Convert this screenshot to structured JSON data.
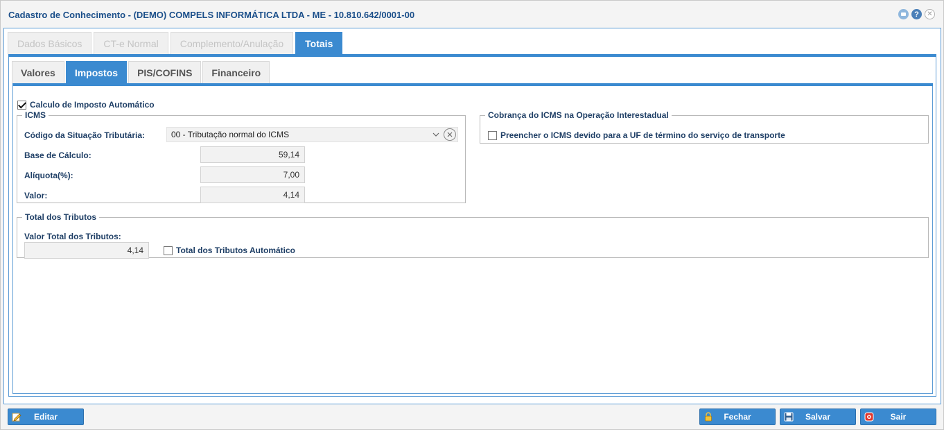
{
  "window": {
    "title": "Cadastro de Conhecimento - (DEMO) COMPELS INFORMÁTICA LTDA - ME - 10.810.642/0001-00",
    "help_glyph": "?",
    "close_glyph": "✕"
  },
  "main_tabs": [
    {
      "label": "Dados Básicos",
      "active": false
    },
    {
      "label": "CT-e Normal",
      "active": false
    },
    {
      "label": "Complemento/Anulação",
      "active": false
    },
    {
      "label": "Totais",
      "active": true
    }
  ],
  "sub_tabs": [
    {
      "label": "Valores",
      "active": false
    },
    {
      "label": "Impostos",
      "active": true
    },
    {
      "label": "PIS/COFINS",
      "active": false
    },
    {
      "label": "Financeiro",
      "active": false
    }
  ],
  "auto_tax": {
    "label": "Calculo de Imposto Automático",
    "checked": true
  },
  "icms": {
    "legend": "ICMS",
    "cst_label": "Código da Situação Tributária:",
    "cst_value": "00 - Tributação normal do ICMS",
    "base_label": "Base de Cálculo:",
    "base_value": "59,14",
    "aliquota_label": "Alíquota(%):",
    "aliquota_value": "7,00",
    "valor_label": "Valor:",
    "valor_value": "4,14"
  },
  "interstate": {
    "legend": "Cobrança do ICMS na Operação Interestadual",
    "checkbox_label": "Preencher o ICMS devido para a UF de término do serviço de transporte",
    "checked": false
  },
  "tributos": {
    "legend": "Total dos Tributos",
    "total_label": "Valor Total dos Tributos:",
    "total_value": "4,14",
    "auto_label": "Total dos Tributos Automático",
    "auto_checked": false
  },
  "buttons": {
    "edit": "Editar",
    "close": "Fechar",
    "save": "Salvar",
    "exit": "Sair"
  },
  "colors": {
    "accent": "#3b8ad0",
    "label_text": "#1f3f66",
    "title_text": "#1b4f8a"
  },
  "icons": {
    "edit": "pencil-icon",
    "close": "lock-icon",
    "save": "floppy-disk-icon",
    "exit": "exit-icon"
  }
}
